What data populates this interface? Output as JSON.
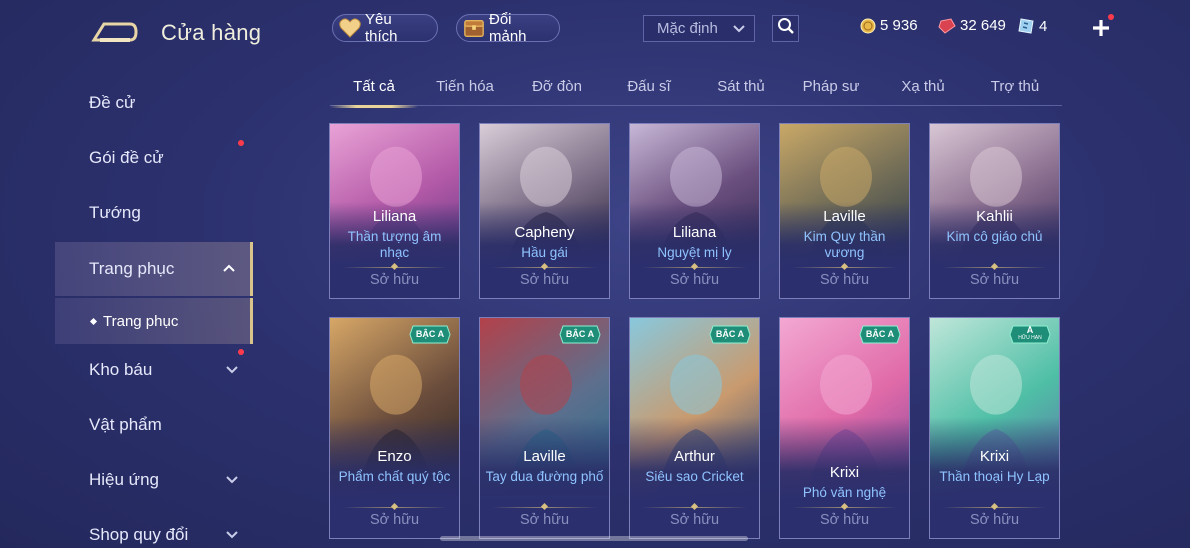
{
  "header": {
    "title": "Cửa hàng",
    "favorite_label": "Yêu thích",
    "fragment_label": "Đổi mảnh",
    "sort_value": "Mặc định",
    "currency": {
      "gold": "5 936",
      "ruby": "32 649",
      "ticket": "4"
    }
  },
  "sidebar": {
    "items": [
      {
        "label": "Đề cử"
      },
      {
        "label": "Gói đề cử"
      },
      {
        "label": "Tướng"
      },
      {
        "label": "Trang phục"
      },
      {
        "label": "Kho báu"
      },
      {
        "label": "Vật phẩm"
      },
      {
        "label": "Hiệu ứng"
      },
      {
        "label": "Shop quy đổi"
      }
    ],
    "sub_item": "Trang phục"
  },
  "tabs": [
    "Tất cả",
    "Tiến hóa",
    "Đỡ đòn",
    "Đấu sĩ",
    "Sát thủ",
    "Pháp sư",
    "Xạ thủ",
    "Trợ thủ"
  ],
  "cards": [
    {
      "hero": "Liliana",
      "skin": "Thần tượng âm nhạc",
      "status": "Sở hữu",
      "colors": [
        "#e9a2d6",
        "#b45aa8",
        "#6b3a86"
      ]
    },
    {
      "hero": "Capheny",
      "skin": "Hầu gái",
      "status": "Sở hữu",
      "colors": [
        "#d8cdd8",
        "#7c6e86",
        "#2c2440"
      ]
    },
    {
      "hero": "Liliana",
      "skin": "Nguyệt mị ly",
      "status": "Sở hữu",
      "colors": [
        "#c7b7d6",
        "#6a4f7e",
        "#352851"
      ]
    },
    {
      "hero": "Laville",
      "skin": "Kim Quy thần vương",
      "status": "Sở hữu",
      "colors": [
        "#c9a867",
        "#6f6b56",
        "#2d3a4a"
      ]
    },
    {
      "hero": "Kahlii",
      "skin": "Kim cô giáo chủ",
      "status": "Sở hữu",
      "colors": [
        "#d8c6d4",
        "#8a6e8f",
        "#3d2f5b"
      ]
    },
    {
      "hero": "Enzo",
      "skin": "Phẩm chất quý tộc",
      "status": "Sở hữu",
      "tier": "BẬC A",
      "colors": [
        "#d7a767",
        "#6b4d3c",
        "#2a2323"
      ]
    },
    {
      "hero": "Laville",
      "skin": "Tay đua đường phố",
      "status": "Sở hữu",
      "tier": "BẬC A",
      "colors": [
        "#b3414a",
        "#5d6f8d",
        "#2a6d8c"
      ]
    },
    {
      "hero": "Arthur",
      "skin": "Siêu sao Cricket",
      "status": "Sở hữu",
      "tier": "BẬC A",
      "colors": [
        "#88c8dd",
        "#c99a6e",
        "#3e4f74"
      ]
    },
    {
      "hero": "Krixi",
      "skin": "Phó văn nghệ",
      "status": "Sở hữu",
      "tier": "BẬC A",
      "colors": [
        "#f3a8d2",
        "#e06aa8",
        "#8a4a9e"
      ]
    },
    {
      "hero": "Krixi",
      "skin": "Thần thoại Hy Lạp",
      "status": "Sở hữu",
      "tier": "A",
      "tier_sub": "HỮU HẠN",
      "colors": [
        "#bfe6d9",
        "#4fbfa6",
        "#5d74a8"
      ]
    }
  ]
}
